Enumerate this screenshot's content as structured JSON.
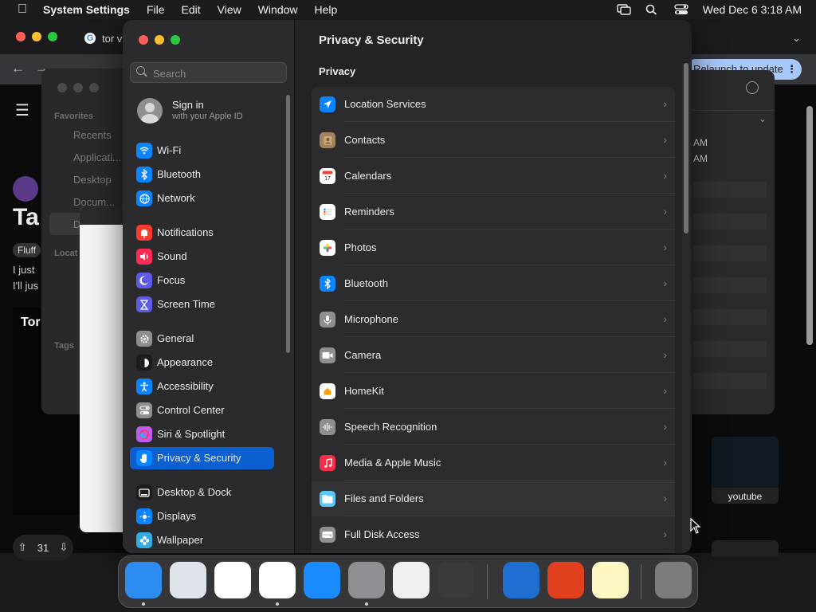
{
  "menubar": {
    "app_name": "System Settings",
    "menus": [
      "File",
      "Edit",
      "View",
      "Window",
      "Help"
    ],
    "clock": "Wed Dec 6  3:18 AM"
  },
  "background": {
    "chrome_tab_title": "tor v",
    "update_button": "Relaunch to update",
    "post_title": "Ta",
    "post_flair": "Fluff",
    "post_line1": "I just",
    "post_line2": "I'll jus",
    "tor_logo": "Tor",
    "vote_count": "31",
    "youtube_label": "youtube",
    "finder": {
      "favorites": "Favorites",
      "items": [
        "Recents",
        "Applicati...",
        "Desktop",
        "Docum...",
        "D"
      ],
      "locations": "Locat",
      "tags": "Tags"
    },
    "rpanel_times": [
      "AM",
      "AM"
    ]
  },
  "sidebar": {
    "search_placeholder": "Search",
    "signin_title": "Sign in",
    "signin_sub": "with your Apple ID",
    "items": [
      {
        "label": "Wi-Fi",
        "color": "#0a84ff",
        "icon": "wifi-icon"
      },
      {
        "label": "Bluetooth",
        "color": "#0a84ff",
        "icon": "bluetooth-icon"
      },
      {
        "label": "Network",
        "color": "#0a84ff",
        "icon": "globe-icon"
      },
      {
        "label": "Notifications",
        "color": "#ff3b30",
        "icon": "bell-icon"
      },
      {
        "label": "Sound",
        "color": "#ff2d55",
        "icon": "speaker-icon"
      },
      {
        "label": "Focus",
        "color": "#5e5ce6",
        "icon": "moon-icon"
      },
      {
        "label": "Screen Time",
        "color": "#5e5ce6",
        "icon": "hourglass-icon"
      },
      {
        "label": "General",
        "color": "#8e8e93",
        "icon": "gear-icon"
      },
      {
        "label": "Appearance",
        "color": "#1c1c1e",
        "icon": "appearance-icon"
      },
      {
        "label": "Accessibility",
        "color": "#0a84ff",
        "icon": "accessibility-icon"
      },
      {
        "label": "Control Center",
        "color": "#8e8e93",
        "icon": "toggles-icon"
      },
      {
        "label": "Siri & Spotlight",
        "color": "#bf5af2",
        "icon": "siri-icon"
      },
      {
        "label": "Privacy & Security",
        "color": "#0a84ff",
        "icon": "hand-icon"
      },
      {
        "label": "Desktop & Dock",
        "color": "#1c1c1e",
        "icon": "dock-icon"
      },
      {
        "label": "Displays",
        "color": "#0a84ff",
        "icon": "sun-icon"
      },
      {
        "label": "Wallpaper",
        "color": "#32ade6",
        "icon": "flower-icon"
      }
    ]
  },
  "content": {
    "title": "Privacy & Security",
    "section": "Privacy",
    "rows": [
      {
        "label": "Location Services",
        "color": "#0a84ff",
        "icon": "location-arrow-icon"
      },
      {
        "label": "Contacts",
        "color": "#a2845e",
        "icon": "contacts-icon"
      },
      {
        "label": "Calendars",
        "color": "#ffffff",
        "icon": "calendar-icon"
      },
      {
        "label": "Reminders",
        "color": "#ffffff",
        "icon": "reminders-icon"
      },
      {
        "label": "Photos",
        "color": "#ffffff",
        "icon": "photos-icon"
      },
      {
        "label": "Bluetooth",
        "color": "#0a84ff",
        "icon": "bluetooth-icon"
      },
      {
        "label": "Microphone",
        "color": "#8e8e93",
        "icon": "microphone-icon"
      },
      {
        "label": "Camera",
        "color": "#8e8e93",
        "icon": "camera-icon"
      },
      {
        "label": "HomeKit",
        "color": "#ffffff",
        "icon": "home-icon"
      },
      {
        "label": "Speech Recognition",
        "color": "#8e8e93",
        "icon": "waveform-icon"
      },
      {
        "label": "Media & Apple Music",
        "color": "#fa2d48",
        "icon": "music-note-icon"
      },
      {
        "label": "Files and Folders",
        "color": "#5ac8fa",
        "icon": "folder-icon"
      },
      {
        "label": "Full Disk Access",
        "color": "#8e8e93",
        "icon": "disk-icon"
      }
    ]
  },
  "dock": [
    {
      "name": "finder-app",
      "color": "#2d8cf0",
      "running": true
    },
    {
      "name": "launchpad-app",
      "color": "#dfe3ea",
      "running": false
    },
    {
      "name": "safari-app",
      "color": "#ffffff",
      "running": false
    },
    {
      "name": "chrome-app",
      "color": "#ffffff",
      "running": true
    },
    {
      "name": "app-store-app",
      "color": "#1a8cff",
      "running": false
    },
    {
      "name": "system-settings-app",
      "color": "#8e8e93",
      "running": true
    },
    {
      "name": "textedit-app",
      "color": "#f1f1f1",
      "running": false
    },
    {
      "name": "garageband-app",
      "color": "#3a3a3a",
      "running": false
    },
    {
      "name": "weather-app",
      "color": "#1f6fd1",
      "running": false
    },
    {
      "name": "remote-desktop-app",
      "color": "#e0401e",
      "running": false
    },
    {
      "name": "notes-app",
      "color": "#fff7c2",
      "running": false
    },
    {
      "name": "trash-app",
      "color": "#7c7c7e",
      "running": false
    }
  ]
}
